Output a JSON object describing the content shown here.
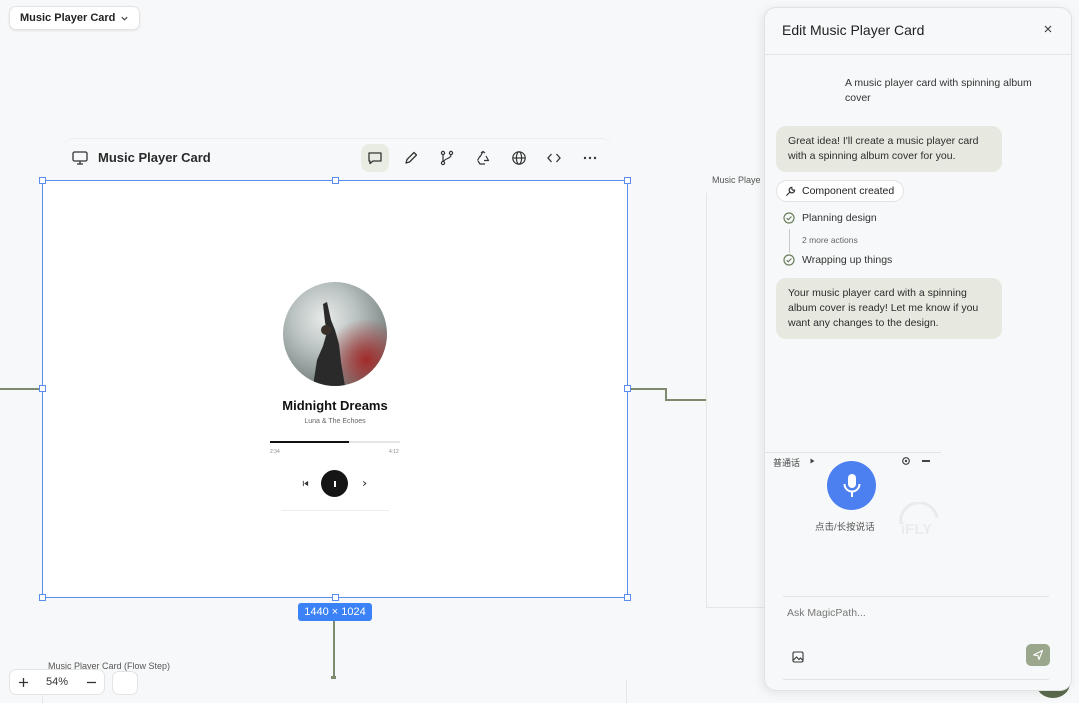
{
  "project": {
    "name": "Music Player Card"
  },
  "frame": {
    "title": "Music Player Card",
    "size_badge": "1440 × 1024"
  },
  "toolbar": {
    "icons": [
      "chat-icon",
      "pencil-icon",
      "branch-icon",
      "recycle-icon",
      "globe-icon",
      "code-icon",
      "more-icon"
    ],
    "active": "chat-icon"
  },
  "player": {
    "song": "Midnight Dreams",
    "artist": "Luna & The Echoes",
    "current_time": "2:34",
    "total_time": "4:12",
    "progress_fraction": 0.61
  },
  "canvas": {
    "right_label": "Music Playe",
    "bottom_label": "Music Player Card (Flow Step)"
  },
  "zoom": {
    "level": "54%"
  },
  "panel": {
    "title": "Edit Music Player Card",
    "user_message": "A music player card with spinning album cover",
    "assistant_message_1": "Great idea! I'll create a music player card with a spinning album cover for you.",
    "component_chip": "Component created",
    "steps": {
      "planning": "Planning design",
      "more": "2 more actions",
      "wrapping": "Wrapping up things"
    },
    "assistant_message_2": "Your music player card with a spinning album cover is ready! Let me know if you want any changes to the design.",
    "voice": {
      "label": "普通话",
      "hint": "点击/长按说话",
      "brand": "iFLY"
    },
    "input_placeholder": "Ask MagicPath..."
  },
  "colors": {
    "selection": "#5b8def",
    "badge": "#3b82f6",
    "bubble": "#e7e9e0",
    "mic": "#4c7fef",
    "connector": "#7d8a6e"
  }
}
